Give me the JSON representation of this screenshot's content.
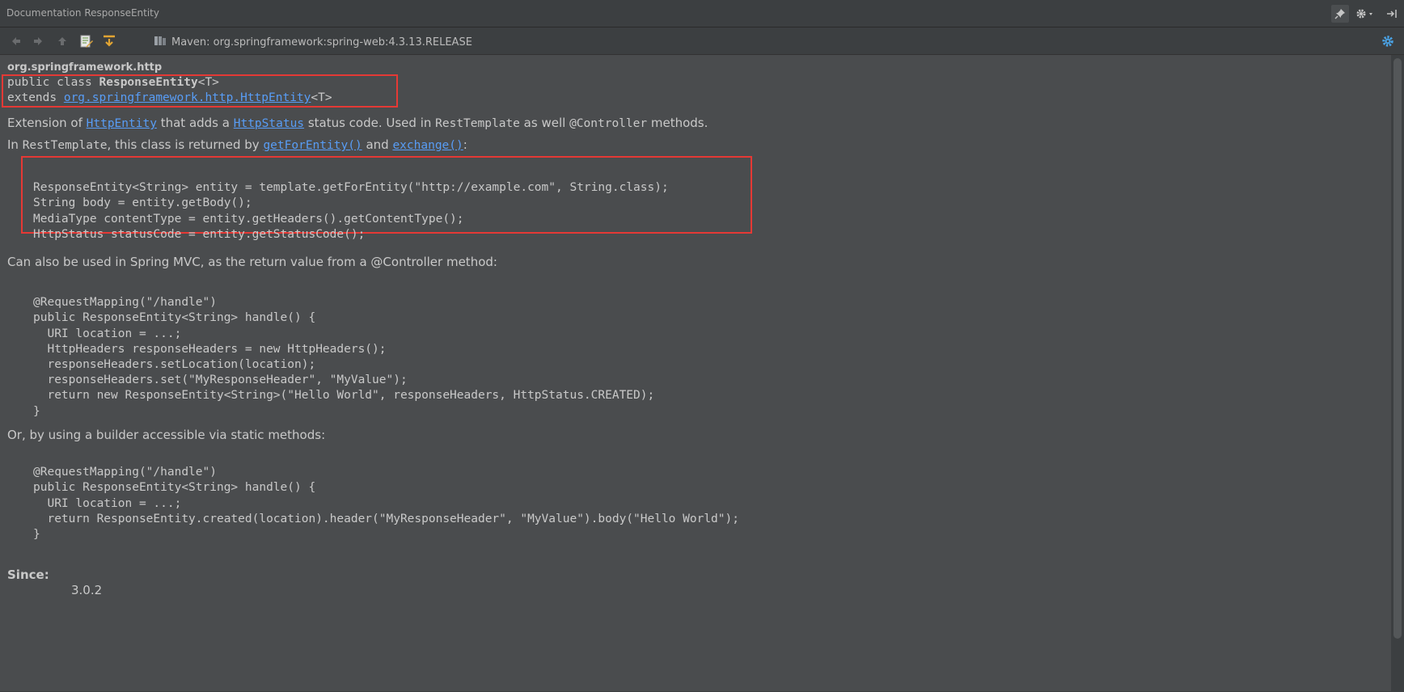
{
  "window": {
    "title": "Documentation ResponseEntity"
  },
  "toolbar": {
    "maven_label": "Maven: org.springframework:spring-web:4.3.13.RELEASE"
  },
  "doc": {
    "package": "org.springframework.http",
    "decl": {
      "prefix": "public class ",
      "class_name": "ResponseEntity",
      "type_param": "<T>",
      "extends_kw": "extends ",
      "extends_link": "org.springframework.http.HttpEntity",
      "extends_tp": "<T>"
    },
    "para1": {
      "t1": "Extension of ",
      "link1": "HttpEntity",
      "t2": " that adds a ",
      "link2": "HttpStatus",
      "t3": " status code. Used in ",
      "code1": "RestTemplate",
      "t4": " as well ",
      "code2": "@Controller",
      "t5": " methods."
    },
    "para2": {
      "t1": "In ",
      "code1": "RestTemplate",
      "t2": ", this class is returned by ",
      "link1": "getForEntity()",
      "t3": " and ",
      "link2": "exchange()",
      "t4": ":"
    },
    "code1": [
      "ResponseEntity<String> entity = template.getForEntity(\"http://example.com\", String.class);",
      "String body = entity.getBody();",
      "MediaType contentType = entity.getHeaders().getContentType();",
      "HttpStatus statusCode = entity.getStatusCode();"
    ],
    "para3": "Can also be used in Spring MVC, as the return value from a @Controller method:",
    "code2": [
      "@RequestMapping(\"/handle\")",
      "public ResponseEntity<String> handle() {",
      "  URI location = ...;",
      "  HttpHeaders responseHeaders = new HttpHeaders();",
      "  responseHeaders.setLocation(location);",
      "  responseHeaders.set(\"MyResponseHeader\", \"MyValue\");",
      "  return new ResponseEntity<String>(\"Hello World\", responseHeaders, HttpStatus.CREATED);",
      "}"
    ],
    "para4": "Or, by using a builder accessible via static methods:",
    "code3": [
      "@RequestMapping(\"/handle\")",
      "public ResponseEntity<String> handle() {",
      "  URI location = ...;",
      "  return ResponseEntity.created(location).header(\"MyResponseHeader\", \"MyValue\").body(\"Hello World\");",
      "}"
    ],
    "since_label": "Since:",
    "since_value": "3.0.2"
  }
}
